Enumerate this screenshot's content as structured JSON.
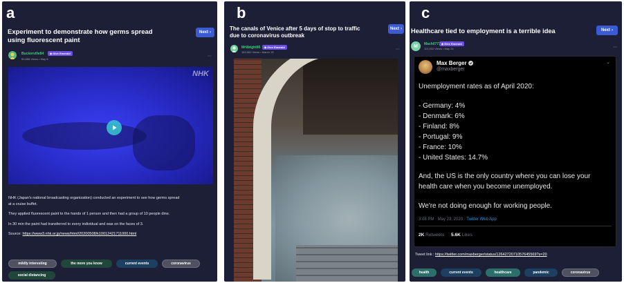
{
  "colors": {
    "panel_bg": "#1d1f36",
    "accent_button": "#3b5bd4",
    "username_green": "#39d07a",
    "badge_purple": "#6a4fe2",
    "tweet_bg": "#000000"
  },
  "panels": {
    "a": {
      "letter": "a",
      "title_line1": "Experiment to demonstrate how germs spread",
      "title_line2": "using fluorescent paint",
      "next_label": "Next",
      "username": "Buckerville84",
      "badge": "Give Emerald",
      "meta": "50,688 Views • May 8",
      "video_watermark": "NHK",
      "paragraphs": [
        "NHK (Japan's national broadcasting organization) conducted an experiment to see how germs spread",
        "at a cruise buffet.",
        "They applied fluorescent paint to the hands of 1 person and then had a group of 10 people dine.",
        "In 30 min the paint had transferred to every individual and was on the faces of 3."
      ],
      "source_label": "Source:",
      "source_link": "https://www3.nhk.or.jp/news/html/20200508/k10012421711000.html",
      "tags": [
        "mildly interesting",
        "the more you know",
        "current events",
        "coronavirus",
        "social distancing"
      ]
    },
    "b": {
      "letter": "b",
      "title_line1": "The canals of Venice after 5 days of stop to traffic",
      "title_line2": "due to coronavirus outbreak",
      "next_label": "Next",
      "username": "MrWright85",
      "badge": "Give Emerald",
      "meta": "183,962 Views • March 15"
    },
    "c": {
      "letter": "c",
      "title": "Healthcare tied to employment is a terrible idea",
      "next_label": "Next",
      "username": "Mach0771",
      "badge": "Give Emerald",
      "meta": "113,502 Views • May 24",
      "avatar_letter": "M",
      "tweet": {
        "author": "Max Berger",
        "handle": "@maxberger",
        "lines": [
          "Unemployment rates as of April 2020:",
          "- Germany: 4%",
          "- Denmark: 6%",
          "- Finland: 8%",
          "- Portugal: 9%",
          "- France: 10%",
          "- United States: 14.7%",
          "And, the US is the only country where you can lose your",
          "health care when you become unemployed.",
          "We're not doing enough for working people."
        ],
        "time": "3:08 PM · May 23, 2020 ·",
        "app": "Twitter Web App",
        "retweets_count": "2K",
        "retweets_label": "Retweets",
        "likes_count": "5.6K",
        "likes_label": "Likes"
      },
      "tweet_link_label": "Tweet link :",
      "tweet_link": "https://twitter.com/maxberger/status/1264272071057645569?s=20",
      "tags": [
        "health",
        "current events",
        "healthcare",
        "pandemic",
        "coronavirus"
      ]
    }
  }
}
